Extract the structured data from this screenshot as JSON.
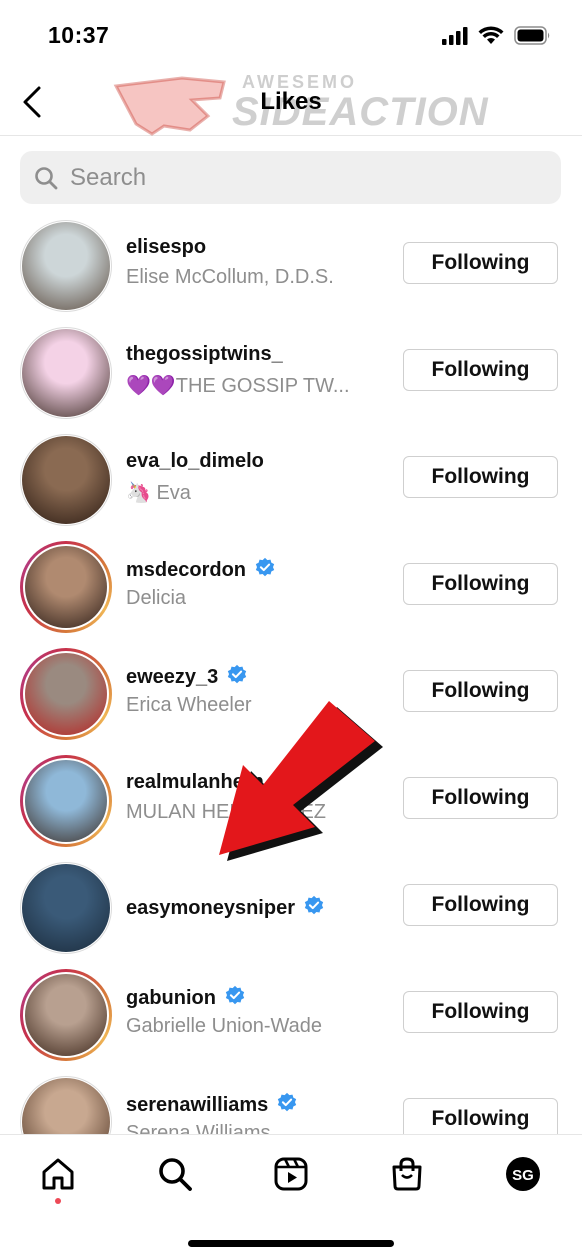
{
  "status_bar": {
    "time": "10:37"
  },
  "header": {
    "title": "Likes"
  },
  "watermark": {
    "top": "AWESEMO",
    "bottom": "SIDEACTION"
  },
  "search": {
    "placeholder": "Search"
  },
  "users": [
    {
      "username": "elisespo",
      "full_name": "Elise McCollum, D.D.S.",
      "verified": false,
      "story_ring": false,
      "button": "Following",
      "avatar_colors": [
        "#cdd6d8",
        "#5a4a3e"
      ]
    },
    {
      "username": "thegossiptwins_",
      "full_name": "💜💜THE GOSSIP TW...",
      "verified": false,
      "story_ring": false,
      "button": "Following",
      "avatar_colors": [
        "#f4d2e6",
        "#3a2a22"
      ]
    },
    {
      "username": "eva_lo_dimelo",
      "full_name": "🦄 Eva",
      "verified": false,
      "story_ring": false,
      "button": "Following",
      "avatar_colors": [
        "#8a6a52",
        "#2a1a12"
      ]
    },
    {
      "username": "msdecordon",
      "full_name": "Delicia",
      "verified": true,
      "story_ring": true,
      "button": "Following",
      "avatar_colors": [
        "#b08a70",
        "#2b1c16"
      ]
    },
    {
      "username": "eweezy_3",
      "full_name": "Erica Wheeler",
      "verified": true,
      "story_ring": true,
      "button": "Following",
      "avatar_colors": [
        "#9a8a80",
        "#b8201e"
      ]
    },
    {
      "username": "realmulanhern",
      "full_name": "MULAN HERNANDEZ",
      "verified": false,
      "story_ring": true,
      "button": "Following",
      "avatar_colors": [
        "#8fb8d8",
        "#3a2c24"
      ]
    },
    {
      "username": "easymoneysniper",
      "full_name": "",
      "verified": true,
      "story_ring": false,
      "button": "Following",
      "avatar_colors": [
        "#3a5a78",
        "#1a2a3a"
      ]
    },
    {
      "username": "gabunion",
      "full_name": "Gabrielle Union-Wade",
      "verified": true,
      "story_ring": true,
      "button": "Following",
      "avatar_colors": [
        "#b8a090",
        "#3a2418"
      ]
    },
    {
      "username": "serenawilliams",
      "full_name": "Serena Williams",
      "verified": true,
      "story_ring": false,
      "button": "Following",
      "avatar_colors": [
        "#c8a890",
        "#4a3020"
      ]
    }
  ],
  "tab_bar": {
    "tabs": [
      "home",
      "search",
      "reels",
      "shop",
      "profile"
    ],
    "active": "home",
    "profile_initials": "SG"
  },
  "colors": {
    "accent_blue": "#3897f0",
    "annotation_arrow": "#e3171b",
    "badge_red": "#ed4956"
  }
}
